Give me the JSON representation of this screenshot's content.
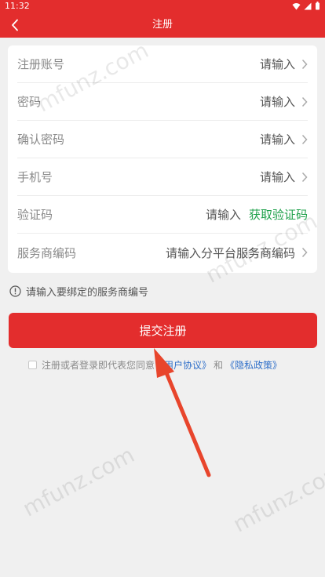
{
  "status_bar": {
    "time": "11:32"
  },
  "app_bar": {
    "title": "注册"
  },
  "form": {
    "rows": [
      {
        "label": "注册账号",
        "value": "请输入"
      },
      {
        "label": "密码",
        "value": "请输入"
      },
      {
        "label": "确认密码",
        "value": "请输入"
      },
      {
        "label": "手机号",
        "value": "请输入"
      },
      {
        "label": "验证码",
        "value": "请输入",
        "action": "获取验证码"
      },
      {
        "label": "服务商编码",
        "value": "请输入分平台服务商编码"
      }
    ]
  },
  "hint": {
    "text": "请输入要绑定的服务商编号"
  },
  "submit": {
    "label": "提交注册"
  },
  "agreement": {
    "prefix": "注册或者登录即代表您同意",
    "user_agreement": "《用户协议》",
    "connector": "和",
    "privacy_policy": "《隐私政策》"
  },
  "watermark": {
    "text": "mfunz.com"
  },
  "colors": {
    "brand": "#e32d2d",
    "action_green": "#1fa14b",
    "link_blue": "#2f6fc9",
    "background": "#f0f0f0"
  }
}
